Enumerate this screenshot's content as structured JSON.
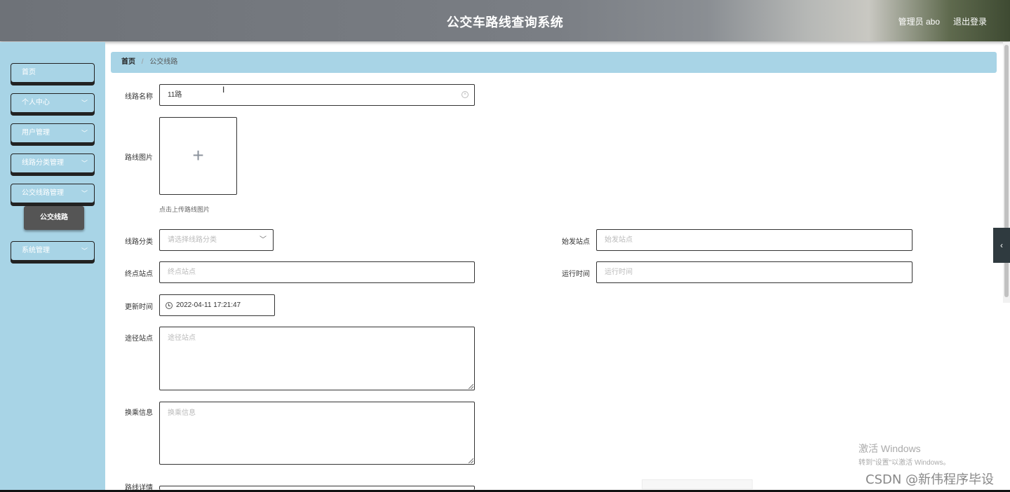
{
  "header": {
    "title": "公交车路线查询系统",
    "user": "管理员 abo",
    "logout": "退出登录"
  },
  "sidebar": {
    "items": [
      {
        "label": "首页",
        "has_arrow": false
      },
      {
        "label": "个人中心",
        "has_arrow": true
      },
      {
        "label": "用户管理",
        "has_arrow": true
      },
      {
        "label": "线路分类管理",
        "has_arrow": true
      },
      {
        "label": "公交线路管理",
        "has_arrow": true
      },
      {
        "label": "系统管理",
        "has_arrow": true
      }
    ],
    "subitem": "公交线路"
  },
  "breadcrumb": {
    "home": "首页",
    "separator": "/",
    "current": "公交线路"
  },
  "form": {
    "route_name": {
      "label": "线路名称",
      "value": "11路"
    },
    "route_image": {
      "label": "路线图片",
      "hint": "点击上传路线图片"
    },
    "route_category": {
      "label": "线路分类",
      "placeholder": "请选择线路分类"
    },
    "start_station": {
      "label": "始发站点",
      "placeholder": "始发站点"
    },
    "end_station": {
      "label": "终点站点",
      "placeholder": "终点站点"
    },
    "run_time": {
      "label": "运行时间",
      "placeholder": "运行时间"
    },
    "update_time": {
      "label": "更新时间",
      "value": "2022-04-11 17:21:47"
    },
    "via_stations": {
      "label": "途径站点",
      "placeholder": "途径站点"
    },
    "transfer_info": {
      "label": "换乘信息",
      "placeholder": "换乘信息"
    },
    "route_detail": {
      "label": "路线详情"
    }
  },
  "icons": {
    "plus": "+",
    "clear": "×",
    "chevron": "⌄",
    "drawer": "‹",
    "cursor": "I"
  },
  "watermark": {
    "activate_title": "激活 Windows",
    "activate_sub": "转到\"设置\"以激活 Windows。",
    "csdn": "CSDN @新伟程序毕设"
  }
}
